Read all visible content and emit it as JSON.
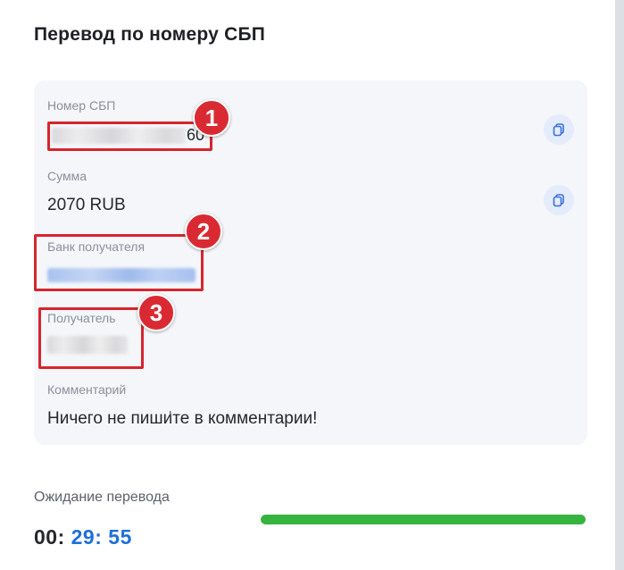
{
  "page": {
    "title": "Перевод по номеру СБП"
  },
  "details": {
    "sbp_number": {
      "label": "Номер СБП",
      "value_visible_tail": "60"
    },
    "amount": {
      "label": "Сумма",
      "value": "2070 RUB"
    },
    "bank": {
      "label": "Банк получателя"
    },
    "recipient": {
      "label": "Получатель"
    },
    "comment": {
      "label": "Комментарий",
      "value": "Ничего не пишите в комментарии!"
    }
  },
  "annotations": {
    "n1": "1",
    "n2": "2",
    "n3": "3"
  },
  "timer": {
    "label": "Ожидание перевода",
    "hours": "00:",
    "minutes_seconds": " 29: 55",
    "progress": 1.0
  },
  "colors": {
    "accent": "#1f6fd9",
    "progress": "#35b43f",
    "annotation": "#d92a33"
  },
  "icons": {
    "copy": "copy-icon"
  }
}
